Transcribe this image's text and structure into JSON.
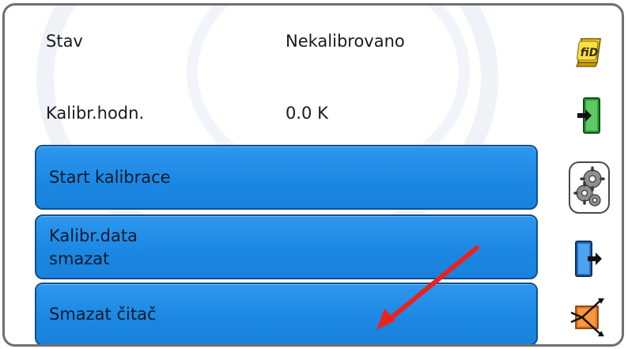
{
  "info": {
    "status_label": "Stav",
    "status_value": "Nekalibrovano",
    "calib_label": "Kalibr.hodn.",
    "calib_value": "0.0 K"
  },
  "buttons": {
    "start_label": "Start kalibrace",
    "delete_data_line1": "Kalibr.data",
    "delete_data_line2": "smazat",
    "delete_counter_label": "Smazat čitač"
  },
  "sidebar": {
    "fid_icon_text": "fiD",
    "icons": [
      "fid-icon",
      "input-icon",
      "gears-icon",
      "output-icon",
      "function-icon"
    ]
  },
  "colors": {
    "button_blue": "#1b87e3",
    "arrow_red": "#e8231e"
  }
}
